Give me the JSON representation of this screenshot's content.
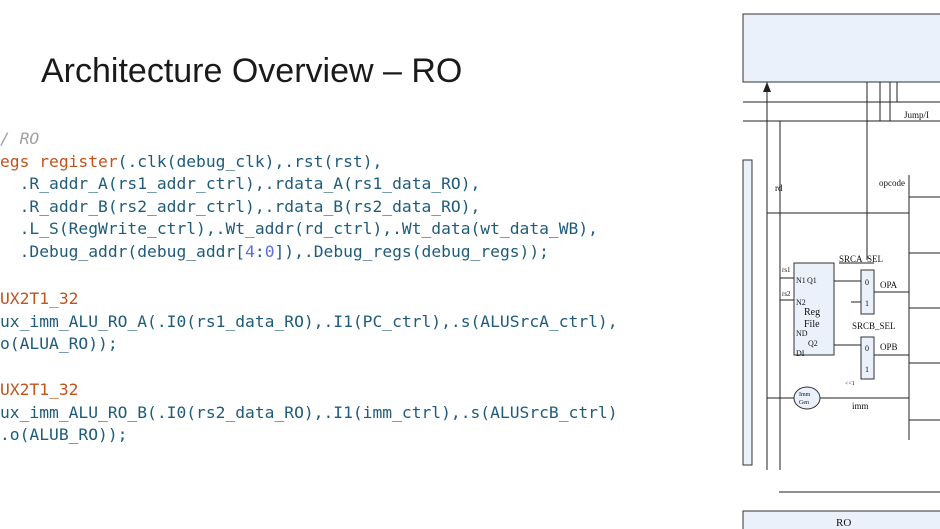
{
  "slide": {
    "title": "Architecture Overview – RO"
  },
  "code": {
    "comment": "/ RO",
    "l1_kw": "egs register",
    "l1_rest": "(.clk(debug_clk),.rst(rst),",
    "l2": "  .R_addr_A(rs1_addr_ctrl),.rdata_A(rs1_data_RO),",
    "l3": "  .R_addr_B(rs2_addr_ctrl),.rdata_B(rs2_data_RO),",
    "l4": "  .L_S(RegWrite_ctrl),.Wt_addr(rd_ctrl),.Wt_data(wt_data_WB),",
    "l5_a": "  .Debug_addr(debug_addr[",
    "l5_n1": "4",
    "l5_colon": ":",
    "l5_n2": "0",
    "l5_b": "]),.Debug_regs(debug_regs));",
    "mux1_type": "UX2T1_32",
    "mux1_l1": "ux_imm_ALU_RO_A(.I0(rs1_data_RO),.I1(PC_ctrl),.s(ALUSrcA_ctrl),",
    "mux1_l2": "o(ALUA_RO));",
    "mux2_type": "UX2T1_32",
    "mux2_l1": "ux_imm_ALU_RO_B(.I0(rs2_data_RO),.I1(imm_ctrl),.s(ALUSrcB_ctrl)",
    "mux2_l2": ".o(ALUB_RO));"
  },
  "diagram": {
    "jump_label": "Jump/I",
    "rd_label": "rd",
    "opcode_label": "opcode",
    "srca_label": "SRCA_SEL",
    "srcb_label": "SRCB_SEL",
    "opa_label": "OPA",
    "opb_label": "OPB",
    "rs1_label": "rs1",
    "rs2_label": "rs2",
    "n1": "N1",
    "q1": "Q1",
    "n2": "N2",
    "reg": "Reg",
    "file": "File",
    "nd": "ND",
    "q2": "Q2",
    "di": "DI",
    "mux_0a": "0",
    "mux_1a": "1",
    "mux_0b": "0",
    "mux_1b": "1",
    "shift_label": "<<1",
    "imm_gen_1": "Imm",
    "imm_gen_2": "Gen",
    "imm_label": "imm",
    "stage_label": "RO"
  }
}
